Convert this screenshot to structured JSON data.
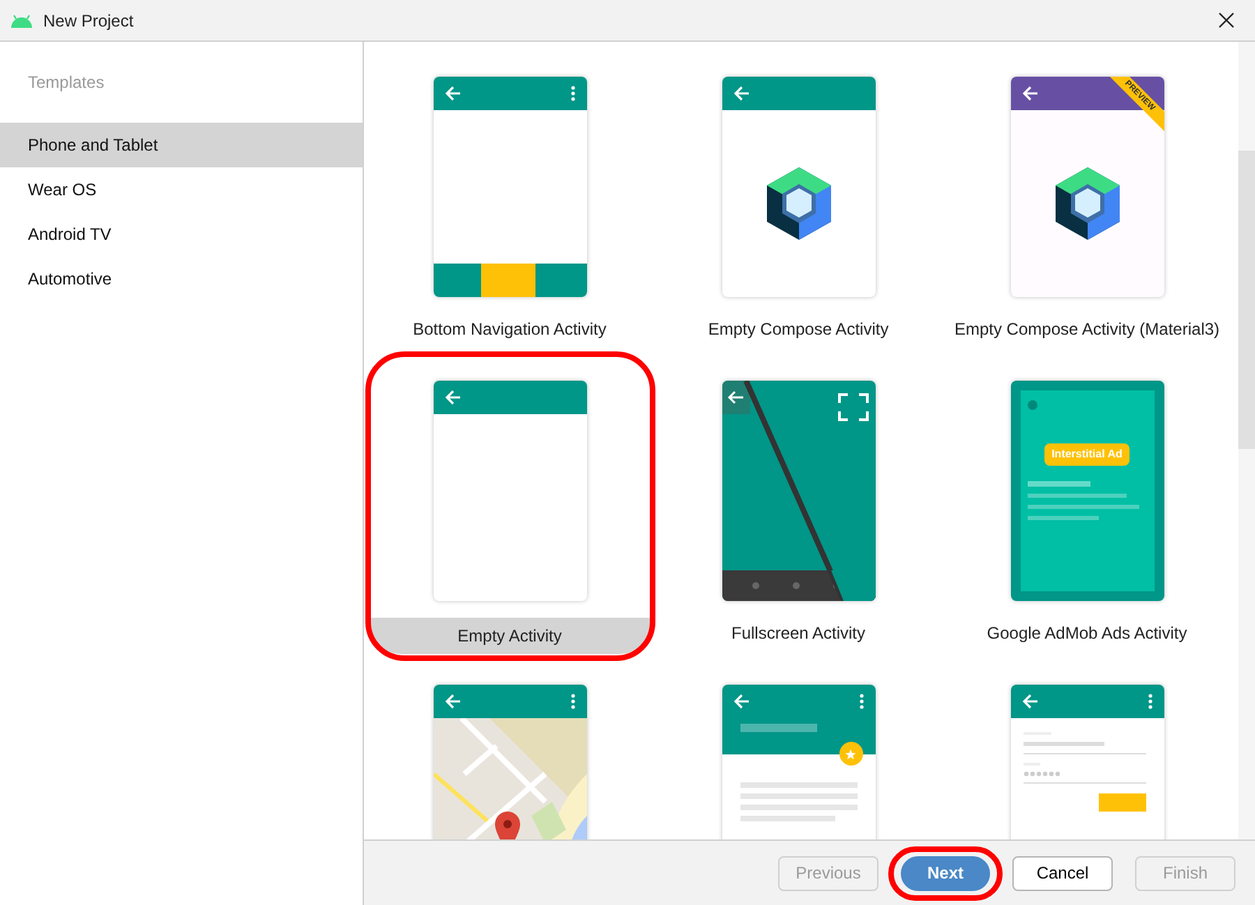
{
  "window": {
    "title": "New Project"
  },
  "sidebar": {
    "heading": "Templates",
    "items": [
      {
        "label": "Phone and Tablet",
        "selected": true
      },
      {
        "label": "Wear OS",
        "selected": false
      },
      {
        "label": "Android TV",
        "selected": false
      },
      {
        "label": "Automotive",
        "selected": false
      }
    ]
  },
  "templates": [
    {
      "kind": "bottom_nav",
      "label": "Bottom Navigation Activity",
      "selected": false,
      "highlighted": false
    },
    {
      "kind": "compose",
      "label": "Empty Compose Activity",
      "selected": false,
      "highlighted": false
    },
    {
      "kind": "compose_m3",
      "label": "Empty Compose Activity (Material3)",
      "badge": "PREVIEW",
      "selected": false,
      "highlighted": false
    },
    {
      "kind": "empty",
      "label": "Empty Activity",
      "selected": true,
      "highlighted": true
    },
    {
      "kind": "fullscreen",
      "label": "Fullscreen Activity",
      "selected": false,
      "highlighted": false
    },
    {
      "kind": "admob",
      "label": "Google AdMob Ads Activity",
      "ad_text": "Interstitial Ad",
      "selected": false,
      "highlighted": false
    },
    {
      "kind": "maps",
      "selected": false,
      "highlighted": false
    },
    {
      "kind": "scrolling",
      "selected": false,
      "highlighted": false
    },
    {
      "kind": "login",
      "selected": false,
      "highlighted": false
    }
  ],
  "buttons": [
    {
      "label": "Previous",
      "kind": "normal",
      "disabled": true,
      "highlighted": false
    },
    {
      "label": "Next",
      "kind": "primary",
      "disabled": false,
      "highlighted": true
    },
    {
      "label": "Cancel",
      "kind": "normal",
      "disabled": false,
      "highlighted": false
    },
    {
      "label": "Finish",
      "kind": "normal",
      "disabled": true,
      "highlighted": false
    }
  ]
}
